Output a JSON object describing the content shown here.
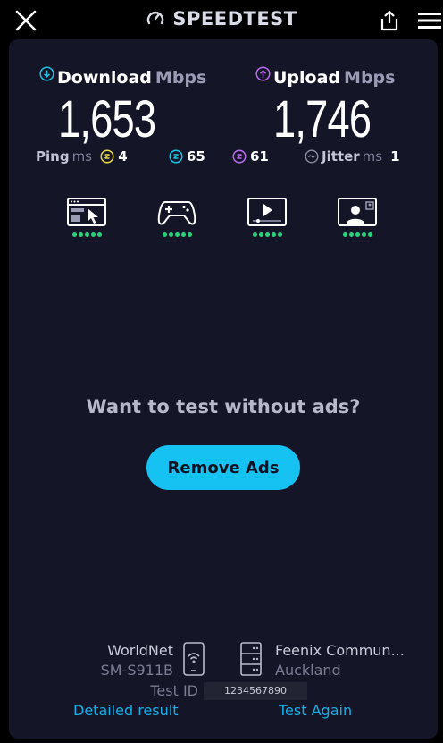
{
  "header": {
    "brand": "SPEEDTEST",
    "icons": {
      "close": "close-icon",
      "logo": "gauge-icon",
      "share": "share-icon",
      "menu": "hamburger-menu-icon"
    }
  },
  "download": {
    "label": "Download",
    "unit": "Mbps",
    "value": "1,653"
  },
  "upload": {
    "label": "Upload",
    "unit": "Mbps",
    "value": "1,746"
  },
  "stats": {
    "ping_label": "Ping",
    "ping_unit": "ms",
    "ping_idle": "4",
    "ping_download": "65",
    "ping_upload": "61",
    "jitter_label": "Jitter",
    "jitter_unit": "ms",
    "jitter_value": "1"
  },
  "quality": [
    {
      "icon": "web-browsing-icon",
      "rating": 5
    },
    {
      "icon": "gaming-controller-icon",
      "rating": 5
    },
    {
      "icon": "video-streaming-icon",
      "rating": 5
    },
    {
      "icon": "video-call-icon",
      "rating": 5
    }
  ],
  "promo": {
    "text": "Want to test without ads?",
    "button": "Remove Ads"
  },
  "footer": {
    "isp": "WorldNet",
    "device": "SM-S911B",
    "server": "Feenix Commun...",
    "location": "Auckland",
    "test_id_label": "Test ID",
    "test_id": "1234567890",
    "detailed_link": "Detailed result",
    "again_link": "Test Again"
  },
  "colors": {
    "background": "#000000",
    "panel": "#141526",
    "accent_download": "#19c4e2",
    "accent_upload": "#b96cf0",
    "ping_idle": "#e5d64a",
    "good_dot": "#2ad07a",
    "button": "#16c2f2",
    "link": "#16aee6"
  }
}
